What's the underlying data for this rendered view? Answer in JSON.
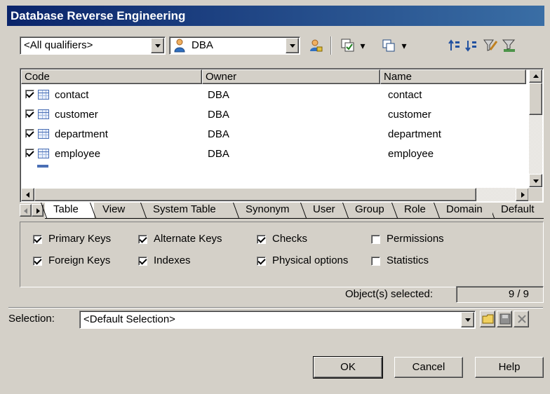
{
  "window": {
    "title": "Database Reverse Engineering"
  },
  "toolbar": {
    "qualifier_value": "<All qualifiers>",
    "owner_value": "DBA",
    "icons": [
      "owner-select-icon",
      "select-all-icon",
      "deselect-icon",
      "move-up-icon",
      "move-down-icon",
      "filter-icon",
      "clear-filter-icon"
    ]
  },
  "list": {
    "columns": [
      "Code",
      "Owner",
      "Name"
    ],
    "rows": [
      {
        "checked": true,
        "code": "contact",
        "owner": "DBA",
        "name": "contact"
      },
      {
        "checked": true,
        "code": "customer",
        "owner": "DBA",
        "name": "customer"
      },
      {
        "checked": true,
        "code": "department",
        "owner": "DBA",
        "name": "department"
      },
      {
        "checked": true,
        "code": "employee",
        "owner": "DBA",
        "name": "employee"
      }
    ]
  },
  "tabs": [
    "Table",
    "View",
    "System Table",
    "Synonym",
    "User",
    "Group",
    "Role",
    "Domain",
    "Default"
  ],
  "active_tab": "Table",
  "options": [
    {
      "label": "Primary Keys",
      "checked": true
    },
    {
      "label": "Alternate Keys",
      "checked": true
    },
    {
      "label": "Checks",
      "checked": true
    },
    {
      "label": "Permissions",
      "checked": false
    },
    {
      "label": "Foreign Keys",
      "checked": true
    },
    {
      "label": "Indexes",
      "checked": true
    },
    {
      "label": "Physical options",
      "checked": true
    },
    {
      "label": "Statistics",
      "checked": false
    }
  ],
  "status": {
    "label": "Object(s) selected:",
    "value": "9 / 9"
  },
  "selection": {
    "label": "Selection:",
    "value": "<Default Selection>"
  },
  "buttons": {
    "ok": "OK",
    "cancel": "Cancel",
    "help": "Help"
  }
}
